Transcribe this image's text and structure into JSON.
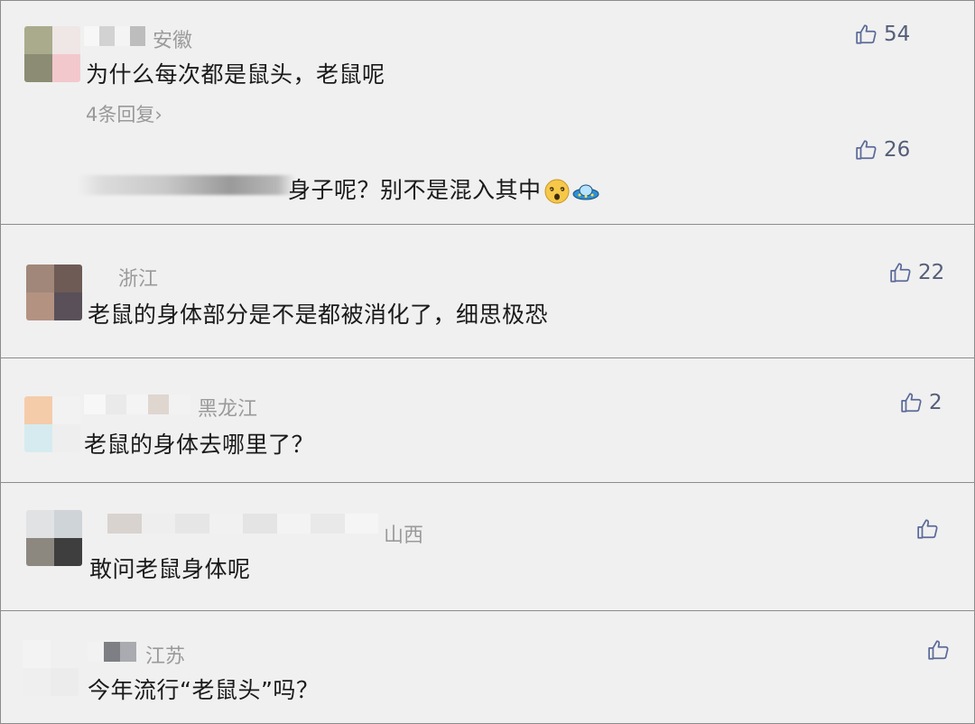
{
  "colors": {
    "background": "#f0f0f0",
    "divider": "#8c8c8c",
    "text": "#1a1a1a",
    "muted": "#9a9a9a",
    "like_icon": "#5b6a99"
  },
  "icons": {
    "like": "thumbs-up-icon",
    "dizzy_face": "dizzy-face-emoji",
    "ufo": "ufo-emoji"
  },
  "comments": [
    {
      "region": "安徽",
      "text": "为什么每次都是鼠头，老鼠呢",
      "likes": "54",
      "replies_link": "4条回复",
      "reply": {
        "text": "身子呢？别不是混入其中",
        "likes": "26"
      }
    },
    {
      "region": "浙江",
      "text": "老鼠的身体部分是不是都被消化了，细思极恐",
      "likes": "22"
    },
    {
      "region": "黑龙江",
      "text": "老鼠的身体去哪里了？",
      "likes": "2"
    },
    {
      "region": "山西",
      "text": "敢问老鼠身体呢",
      "likes": ""
    },
    {
      "region": "江苏",
      "text": "今年流行“老鼠头”吗？",
      "likes": ""
    }
  ]
}
